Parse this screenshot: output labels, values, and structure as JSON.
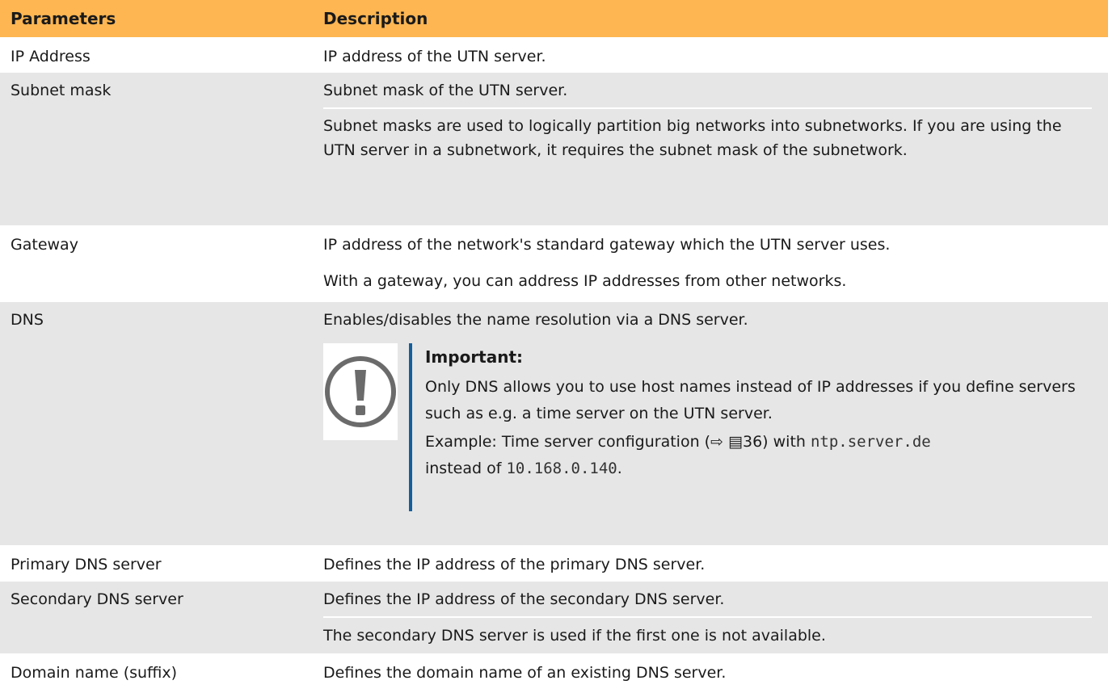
{
  "header": {
    "col1": "Parameters",
    "col2": "Description"
  },
  "rows": {
    "ip": {
      "param": "IP Address",
      "desc": "IP address of the UTN server."
    },
    "subnet": {
      "param": "Subnet mask",
      "desc1": "Subnet mask of the UTN server.",
      "desc2": "Subnet masks are used to logically partition big networks into subnetworks. If you are using the UTN server in a subnetwork, it requires the subnet mask of the subnetwork."
    },
    "gateway": {
      "param": "Gateway",
      "desc1": "IP address of the network's standard gateway which the UTN server uses.",
      "desc2": "With a gateway, you can address IP addresses from other networks."
    },
    "dns": {
      "param": "DNS",
      "desc": "Enables/disables the name resolution via a DNS server.",
      "important": {
        "icon": "exclamation-circle-icon",
        "title": "Important:",
        "text": "Only DNS allows you to use host names instead of IP addresses if you define servers such as e.g. a time server on the UTN server.",
        "example_prefix": "Example: Time server configuration (",
        "example_ref_arrow": "⇨",
        "example_ref_page_icon": "▤",
        "example_ref_page": "36",
        "example_mid": ") with ",
        "example_code1": "ntp.server.de",
        "example_instead": "instead of ",
        "example_code2": "10.168.0.140",
        "example_end": "."
      }
    },
    "primary_dns": {
      "param": "Primary DNS server",
      "desc": "Defines the IP address of the primary DNS server."
    },
    "secondary_dns": {
      "param": "Secondary DNS server",
      "desc1": "Defines the IP address of the secondary DNS server.",
      "desc2": "The secondary DNS server is used if the first one is not available."
    },
    "domain": {
      "param": "Domain name (suffix)",
      "desc": "Defines the domain name of an existing DNS server."
    }
  },
  "colors": {
    "header_bg": "#fdb652",
    "row_grey": "#e6e6e6",
    "accent_bar": "#135f9e"
  }
}
